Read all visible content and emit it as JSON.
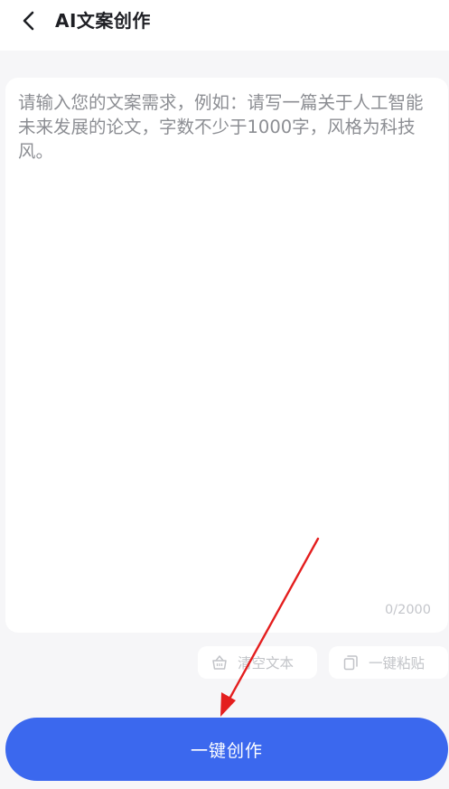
{
  "header": {
    "back_icon": "chevron-left-icon",
    "title": "AI文案创作"
  },
  "editor": {
    "placeholder": "请输入您的文案需求，例如：请写一篇关于人工智能未来发展的论文，字数不少于1000字，风格为科技风。",
    "value": "",
    "char_count": "0/2000"
  },
  "tools": {
    "clear": {
      "label": "清空文本",
      "icon": "basket-icon"
    },
    "paste": {
      "label": "一键粘贴",
      "icon": "copy-icon"
    }
  },
  "primary_action": {
    "label": "一键创作"
  },
  "colors": {
    "accent": "#3b68ee",
    "annotation": "#e41e1e",
    "background": "#f6f6f8"
  }
}
